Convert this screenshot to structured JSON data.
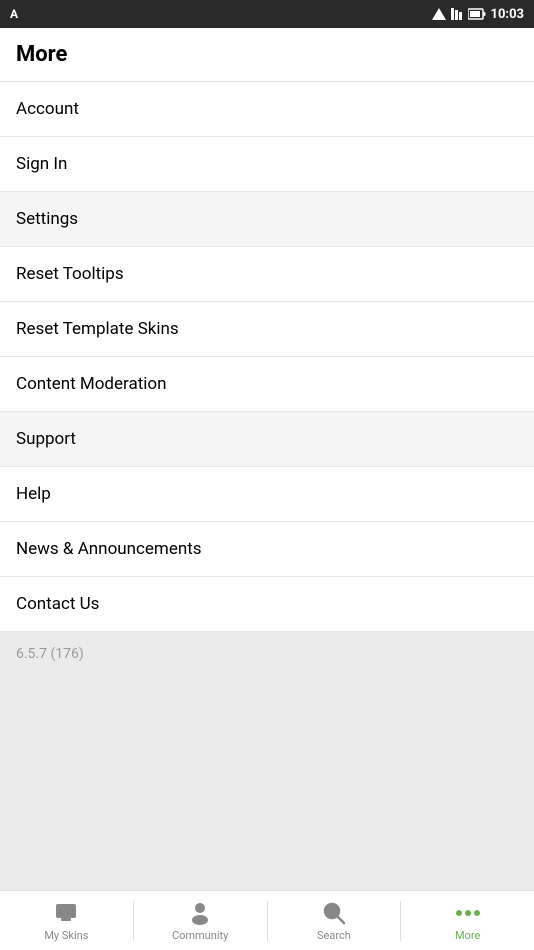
{
  "statusBar": {
    "time": "10:03",
    "aLabel": "A"
  },
  "page": {
    "title": "More"
  },
  "menuItems": [
    {
      "id": "account",
      "label": "Account",
      "grayBg": false
    },
    {
      "id": "sign-in",
      "label": "Sign In",
      "grayBg": false
    },
    {
      "id": "settings",
      "label": "Settings",
      "grayBg": true
    },
    {
      "id": "reset-tooltips",
      "label": "Reset Tooltips",
      "grayBg": false
    },
    {
      "id": "reset-template-skins",
      "label": "Reset Template Skins",
      "grayBg": false
    },
    {
      "id": "content-moderation",
      "label": "Content Moderation",
      "grayBg": false
    },
    {
      "id": "support",
      "label": "Support",
      "grayBg": true
    },
    {
      "id": "help",
      "label": "Help",
      "grayBg": false
    },
    {
      "id": "news-announcements",
      "label": "News & Announcements",
      "grayBg": false
    },
    {
      "id": "contact-us",
      "label": "Contact Us",
      "grayBg": false
    }
  ],
  "version": "6.5.7 (176)",
  "bottomNav": {
    "items": [
      {
        "id": "my-skins",
        "label": "My Skins",
        "active": false
      },
      {
        "id": "community",
        "label": "Community",
        "active": false
      },
      {
        "id": "search",
        "label": "Search",
        "active": false
      },
      {
        "id": "more",
        "label": "More",
        "active": true
      }
    ]
  }
}
